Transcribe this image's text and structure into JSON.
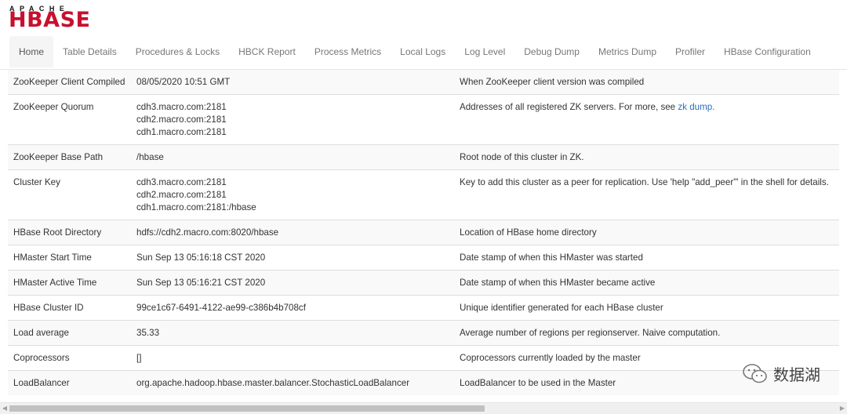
{
  "logo": {
    "top": "APACHE",
    "main": "HBASE"
  },
  "nav": {
    "items": [
      {
        "label": "Home",
        "active": true
      },
      {
        "label": "Table Details"
      },
      {
        "label": "Procedures & Locks"
      },
      {
        "label": "HBCK Report"
      },
      {
        "label": "Process Metrics"
      },
      {
        "label": "Local Logs"
      },
      {
        "label": "Log Level"
      },
      {
        "label": "Debug Dump"
      },
      {
        "label": "Metrics Dump"
      },
      {
        "label": "Profiler"
      },
      {
        "label": "HBase Configuration"
      }
    ]
  },
  "rows": [
    {
      "name": "ZooKeeper Client Compiled",
      "value": [
        "08/05/2020 10:51 GMT"
      ],
      "desc": "When ZooKeeper client version was compiled"
    },
    {
      "name": "ZooKeeper Quorum",
      "value": [
        "cdh3.macro.com:2181",
        "cdh2.macro.com:2181",
        "cdh1.macro.com:2181"
      ],
      "desc": "Addresses of all registered ZK servers. For more, see",
      "desc_link": "zk dump."
    },
    {
      "name": "ZooKeeper Base Path",
      "value": [
        "/hbase"
      ],
      "desc": "Root node of this cluster in ZK."
    },
    {
      "name": "Cluster Key",
      "value": [
        "cdh3.macro.com:2181",
        "cdh2.macro.com:2181",
        "cdh1.macro.com:2181:/hbase"
      ],
      "desc": "Key to add this cluster as a peer for replication. Use 'help \"add_peer\"' in the shell for details."
    },
    {
      "name": "HBase Root Directory",
      "value": [
        "hdfs://cdh2.macro.com:8020/hbase"
      ],
      "desc": "Location of HBase home directory"
    },
    {
      "name": "HMaster Start Time",
      "value": [
        "Sun Sep 13 05:16:18 CST 2020"
      ],
      "desc": "Date stamp of when this HMaster was started"
    },
    {
      "name": "HMaster Active Time",
      "value": [
        "Sun Sep 13 05:16:21 CST 2020"
      ],
      "desc": "Date stamp of when this HMaster became active"
    },
    {
      "name": "HBase Cluster ID",
      "value": [
        "99ce1c67-6491-4122-ae99-c386b4b708cf"
      ],
      "desc": "Unique identifier generated for each HBase cluster"
    },
    {
      "name": "Load average",
      "value": [
        "35.33"
      ],
      "desc": "Average number of regions per regionserver. Naive computation."
    },
    {
      "name": "Coprocessors",
      "value": [
        "[]"
      ],
      "desc": "Coprocessors currently loaded by the master"
    },
    {
      "name": "LoadBalancer",
      "value": [
        "org.apache.hadoop.hbase.master.balancer.StochasticLoadBalancer"
      ],
      "desc": "LoadBalancer to be used in the Master"
    }
  ],
  "watermark": {
    "text": "数据湖",
    "icon": "wechat-icon"
  },
  "scrollbar": {
    "left_arrow": "◀",
    "right_arrow": "▶",
    "icons": [
      "scroll-left-icon",
      "scroll-right-icon"
    ]
  }
}
